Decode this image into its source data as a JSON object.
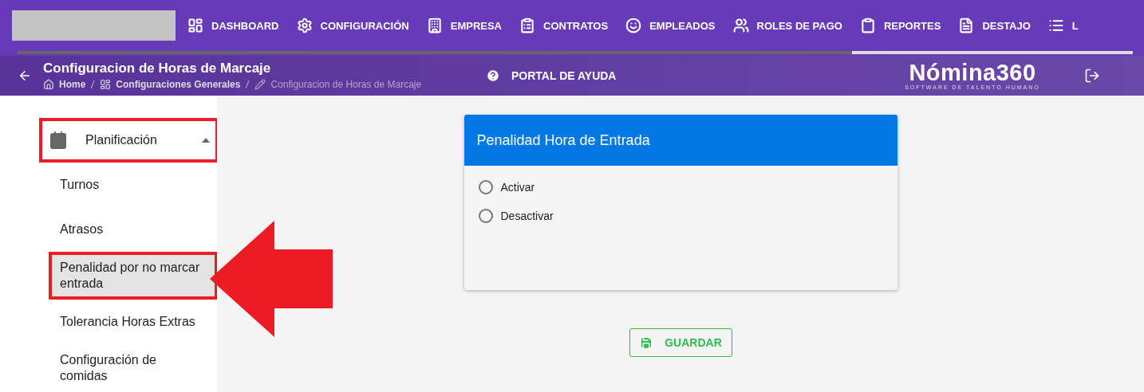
{
  "top_nav": {
    "items": [
      {
        "label": "DASHBOARD"
      },
      {
        "label": "CONFIGURACIÓN"
      },
      {
        "label": "EMPRESA"
      },
      {
        "label": "CONTRATOS"
      },
      {
        "label": "EMPLEADOS"
      },
      {
        "label": "ROLES DE PAGO"
      },
      {
        "label": "REPORTES"
      },
      {
        "label": "DESTAJO"
      },
      {
        "label": "L"
      }
    ]
  },
  "header": {
    "title": "Configuracion de Horas de Marcaje",
    "breadcrumb": [
      {
        "label": "Home"
      },
      {
        "label": "Configuraciones Generales"
      },
      {
        "label": "Configuracion de Horas de Marcaje"
      }
    ],
    "help_link": "PORTAL DE AYUDA",
    "brand": {
      "name": "Nómina360",
      "tagline": "SOFTWARE DE TALENTO HUMANO"
    }
  },
  "sidebar": {
    "items": [
      {
        "label": "Planificación",
        "expanded": true,
        "highlighted": true,
        "children": [
          {
            "label": "Turnos",
            "selected": false,
            "highlighted": false
          },
          {
            "label": "Atrasos",
            "selected": false,
            "highlighted": false
          },
          {
            "label": "Penalidad por no marcar entrada",
            "selected": true,
            "highlighted": true
          },
          {
            "label": "Tolerancia Horas Extras",
            "selected": false,
            "highlighted": false
          },
          {
            "label": "Configuración de comidas",
            "selected": false,
            "highlighted": false
          }
        ]
      }
    ]
  },
  "card": {
    "title": "Penalidad Hora de Entrada",
    "options": [
      {
        "label": "Activar",
        "selected": false
      },
      {
        "label": "Desactivar",
        "selected": false
      }
    ]
  },
  "save_button": "GUARDAR"
}
